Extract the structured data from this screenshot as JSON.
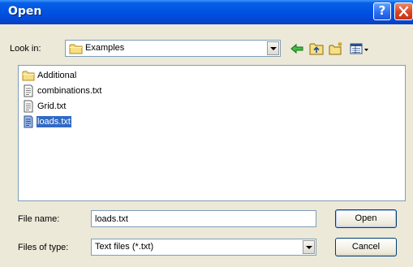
{
  "window": {
    "title": "Open",
    "help_label": "?"
  },
  "lookin": {
    "label": "Look in:",
    "value": "Examples"
  },
  "toolbar": {
    "icons": [
      "back-arrow-icon",
      "up-folder-icon",
      "new-folder-icon",
      "view-menu-icon"
    ]
  },
  "files": [
    {
      "name": "Additional",
      "type": "folder",
      "selected": false
    },
    {
      "name": "combinations.txt",
      "type": "text",
      "selected": false
    },
    {
      "name": "Grid.txt",
      "type": "text",
      "selected": false
    },
    {
      "name": "loads.txt",
      "type": "text",
      "selected": true
    }
  ],
  "filename": {
    "label": "File name:",
    "value": "loads.txt"
  },
  "filetype": {
    "label": "Files of type:",
    "value": "Text files (*.txt)"
  },
  "buttons": {
    "open": "Open",
    "cancel": "Cancel"
  },
  "colors": {
    "title_bar": "#0054e3",
    "selection": "#316ac5",
    "face": "#ece9d8"
  }
}
